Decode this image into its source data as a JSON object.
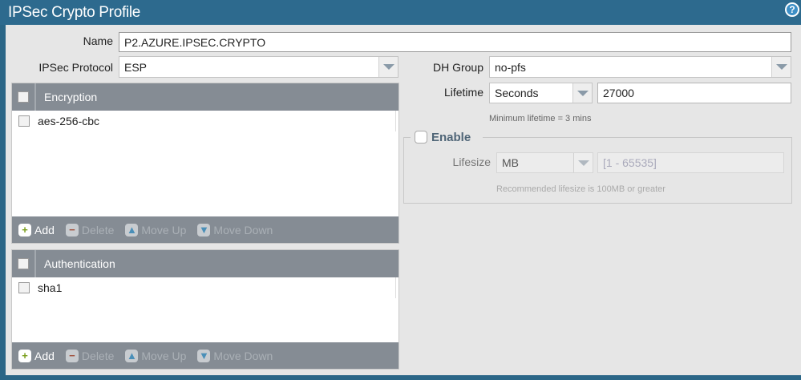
{
  "dialog": {
    "title": "IPSec Crypto Profile",
    "help_icon": "?"
  },
  "form": {
    "name_label": "Name",
    "name_value": "P2.AZURE.IPSEC.CRYPTO",
    "protocol_label": "IPSec Protocol",
    "protocol_value": "ESP",
    "dh_label": "DH Group",
    "dh_value": "no-pfs",
    "lifetime_label": "Lifetime",
    "lifetime_unit": "Seconds",
    "lifetime_value": "27000",
    "lifetime_hint": "Minimum lifetime = 3 mins",
    "enable_label": "Enable",
    "enable_checked": false,
    "lifesize_label": "Lifesize",
    "lifesize_unit": "MB",
    "lifesize_placeholder": "[1 - 65535]",
    "lifesize_hint": "Recommended lifesize is 100MB or greater"
  },
  "encryption": {
    "header": "Encryption",
    "items": [
      "aes-256-cbc"
    ]
  },
  "authentication": {
    "header": "Authentication",
    "items": [
      "sha1"
    ]
  },
  "toolbar": {
    "add": "Add",
    "delete": "Delete",
    "move_up": "Move Up",
    "move_down": "Move Down"
  }
}
